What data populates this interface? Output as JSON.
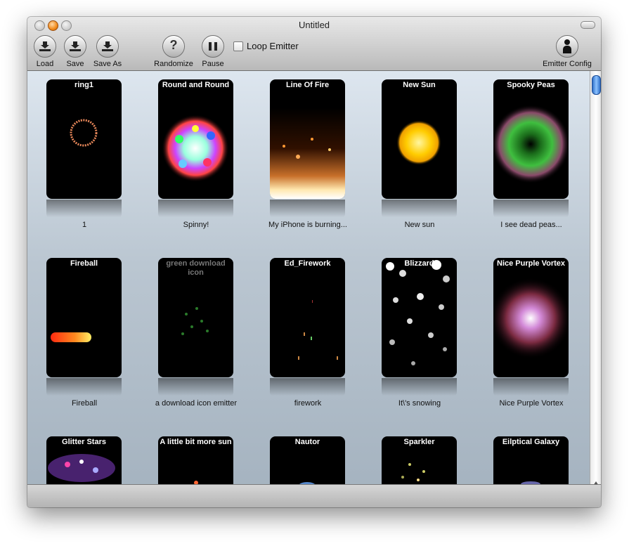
{
  "window": {
    "title": "Untitled"
  },
  "toolbar": {
    "load": {
      "label": "Load",
      "icon": "download-icon"
    },
    "save": {
      "label": "Save",
      "icon": "download-icon"
    },
    "save_as": {
      "label": "Save As",
      "icon": "download-icon"
    },
    "randomize": {
      "label": "Randomize",
      "icon": "question-mark-icon"
    },
    "pause": {
      "label": "Pause",
      "icon": "pause-icon"
    },
    "loop": {
      "label": "Loop Emitter",
      "checked": false
    },
    "emitter_config": {
      "label": "Emitter Config",
      "icon": "person-icon"
    }
  },
  "emitters": [
    {
      "name": "ring1",
      "description": "1"
    },
    {
      "name": "Round and Round",
      "description": "Spinny!"
    },
    {
      "name": "Line Of Fire",
      "description": "My iPhone is burning..."
    },
    {
      "name": "New Sun",
      "description": "New sun"
    },
    {
      "name": "Spooky Peas",
      "description": "I see dead peas..."
    },
    {
      "name": "Fireball",
      "description": "Fireball"
    },
    {
      "name": "green download icon",
      "description": "a download icon emitter"
    },
    {
      "name": "Ed_Firework",
      "description": "firework"
    },
    {
      "name": "Blizzard",
      "description": "It\\'s snowing"
    },
    {
      "name": "Nice Purple Vortex",
      "description": "Nice Purple Vortex"
    },
    {
      "name": "Glitter Stars",
      "description": ""
    },
    {
      "name": "A little bit more sun",
      "description": ""
    },
    {
      "name": "Nautor",
      "description": ""
    },
    {
      "name": "Sparkler",
      "description": ""
    },
    {
      "name": "Eilptical Galaxy",
      "description": ""
    }
  ],
  "colors": {
    "accent_scroll": "#2f6fc8",
    "card_bg": "#000000"
  }
}
